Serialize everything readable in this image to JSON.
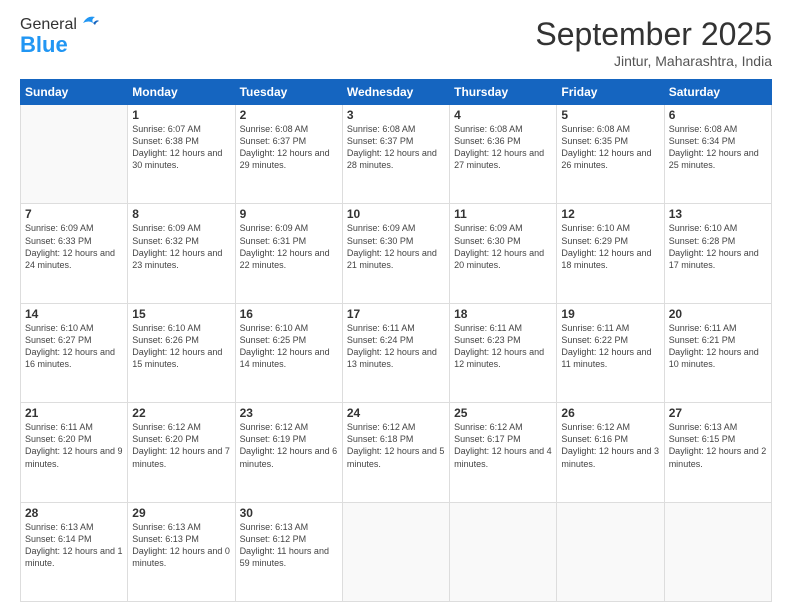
{
  "logo": {
    "general": "General",
    "blue": "Blue"
  },
  "header": {
    "month": "September 2025",
    "location": "Jintur, Maharashtra, India"
  },
  "weekdays": [
    "Sunday",
    "Monday",
    "Tuesday",
    "Wednesday",
    "Thursday",
    "Friday",
    "Saturday"
  ],
  "weeks": [
    [
      {
        "day": "",
        "info": ""
      },
      {
        "day": "1",
        "info": "Sunrise: 6:07 AM\nSunset: 6:38 PM\nDaylight: 12 hours\nand 30 minutes."
      },
      {
        "day": "2",
        "info": "Sunrise: 6:08 AM\nSunset: 6:37 PM\nDaylight: 12 hours\nand 29 minutes."
      },
      {
        "day": "3",
        "info": "Sunrise: 6:08 AM\nSunset: 6:37 PM\nDaylight: 12 hours\nand 28 minutes."
      },
      {
        "day": "4",
        "info": "Sunrise: 6:08 AM\nSunset: 6:36 PM\nDaylight: 12 hours\nand 27 minutes."
      },
      {
        "day": "5",
        "info": "Sunrise: 6:08 AM\nSunset: 6:35 PM\nDaylight: 12 hours\nand 26 minutes."
      },
      {
        "day": "6",
        "info": "Sunrise: 6:08 AM\nSunset: 6:34 PM\nDaylight: 12 hours\nand 25 minutes."
      }
    ],
    [
      {
        "day": "7",
        "info": "Sunrise: 6:09 AM\nSunset: 6:33 PM\nDaylight: 12 hours\nand 24 minutes."
      },
      {
        "day": "8",
        "info": "Sunrise: 6:09 AM\nSunset: 6:32 PM\nDaylight: 12 hours\nand 23 minutes."
      },
      {
        "day": "9",
        "info": "Sunrise: 6:09 AM\nSunset: 6:31 PM\nDaylight: 12 hours\nand 22 minutes."
      },
      {
        "day": "10",
        "info": "Sunrise: 6:09 AM\nSunset: 6:30 PM\nDaylight: 12 hours\nand 21 minutes."
      },
      {
        "day": "11",
        "info": "Sunrise: 6:09 AM\nSunset: 6:30 PM\nDaylight: 12 hours\nand 20 minutes."
      },
      {
        "day": "12",
        "info": "Sunrise: 6:10 AM\nSunset: 6:29 PM\nDaylight: 12 hours\nand 18 minutes."
      },
      {
        "day": "13",
        "info": "Sunrise: 6:10 AM\nSunset: 6:28 PM\nDaylight: 12 hours\nand 17 minutes."
      }
    ],
    [
      {
        "day": "14",
        "info": "Sunrise: 6:10 AM\nSunset: 6:27 PM\nDaylight: 12 hours\nand 16 minutes."
      },
      {
        "day": "15",
        "info": "Sunrise: 6:10 AM\nSunset: 6:26 PM\nDaylight: 12 hours\nand 15 minutes."
      },
      {
        "day": "16",
        "info": "Sunrise: 6:10 AM\nSunset: 6:25 PM\nDaylight: 12 hours\nand 14 minutes."
      },
      {
        "day": "17",
        "info": "Sunrise: 6:11 AM\nSunset: 6:24 PM\nDaylight: 12 hours\nand 13 minutes."
      },
      {
        "day": "18",
        "info": "Sunrise: 6:11 AM\nSunset: 6:23 PM\nDaylight: 12 hours\nand 12 minutes."
      },
      {
        "day": "19",
        "info": "Sunrise: 6:11 AM\nSunset: 6:22 PM\nDaylight: 12 hours\nand 11 minutes."
      },
      {
        "day": "20",
        "info": "Sunrise: 6:11 AM\nSunset: 6:21 PM\nDaylight: 12 hours\nand 10 minutes."
      }
    ],
    [
      {
        "day": "21",
        "info": "Sunrise: 6:11 AM\nSunset: 6:20 PM\nDaylight: 12 hours\nand 9 minutes."
      },
      {
        "day": "22",
        "info": "Sunrise: 6:12 AM\nSunset: 6:20 PM\nDaylight: 12 hours\nand 7 minutes."
      },
      {
        "day": "23",
        "info": "Sunrise: 6:12 AM\nSunset: 6:19 PM\nDaylight: 12 hours\nand 6 minutes."
      },
      {
        "day": "24",
        "info": "Sunrise: 6:12 AM\nSunset: 6:18 PM\nDaylight: 12 hours\nand 5 minutes."
      },
      {
        "day": "25",
        "info": "Sunrise: 6:12 AM\nSunset: 6:17 PM\nDaylight: 12 hours\nand 4 minutes."
      },
      {
        "day": "26",
        "info": "Sunrise: 6:12 AM\nSunset: 6:16 PM\nDaylight: 12 hours\nand 3 minutes."
      },
      {
        "day": "27",
        "info": "Sunrise: 6:13 AM\nSunset: 6:15 PM\nDaylight: 12 hours\nand 2 minutes."
      }
    ],
    [
      {
        "day": "28",
        "info": "Sunrise: 6:13 AM\nSunset: 6:14 PM\nDaylight: 12 hours\nand 1 minute."
      },
      {
        "day": "29",
        "info": "Sunrise: 6:13 AM\nSunset: 6:13 PM\nDaylight: 12 hours\nand 0 minutes."
      },
      {
        "day": "30",
        "info": "Sunrise: 6:13 AM\nSunset: 6:12 PM\nDaylight: 11 hours\nand 59 minutes."
      },
      {
        "day": "",
        "info": ""
      },
      {
        "day": "",
        "info": ""
      },
      {
        "day": "",
        "info": ""
      },
      {
        "day": "",
        "info": ""
      }
    ]
  ]
}
